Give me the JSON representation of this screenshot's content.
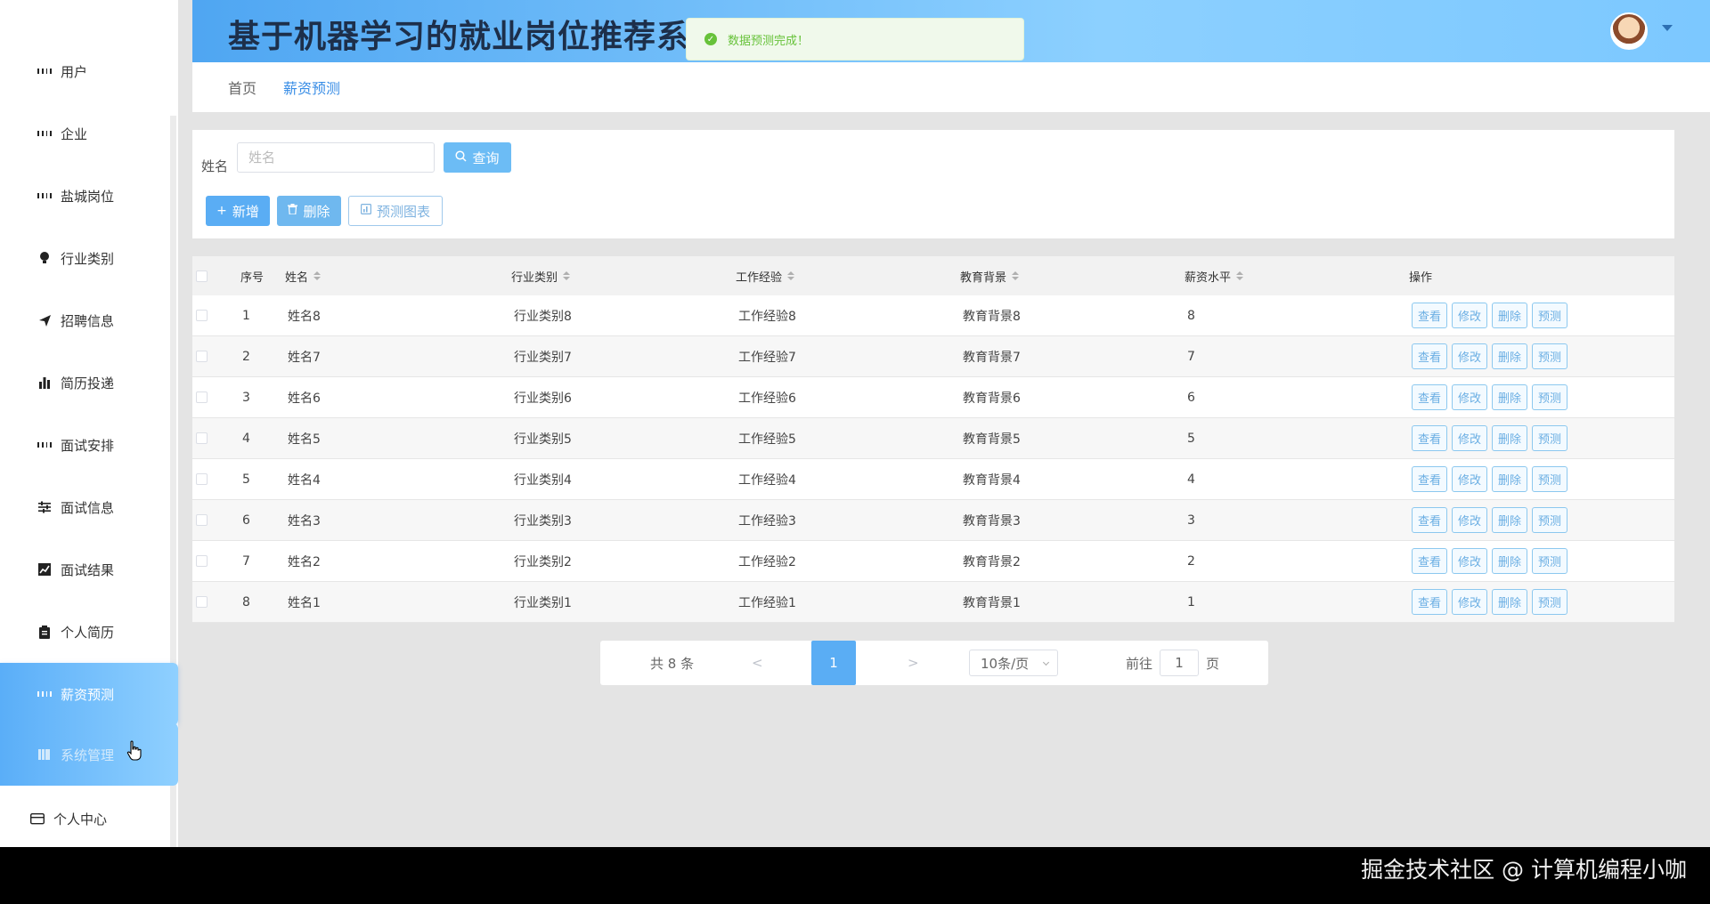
{
  "header": {
    "title": "基于机器学习的就业岗位推荐系统"
  },
  "toast": {
    "message": "数据预测完成！"
  },
  "sidebar": {
    "items": [
      {
        "label": "用户",
        "icon": "grid-icon"
      },
      {
        "label": "企业",
        "icon": "grid-icon"
      },
      {
        "label": "盐城岗位",
        "icon": "grid-icon"
      },
      {
        "label": "行业类别",
        "icon": "bulb-icon"
      },
      {
        "label": "招聘信息",
        "icon": "send-icon"
      },
      {
        "label": "简历投递",
        "icon": "bar-chart-icon"
      },
      {
        "label": "面试安排",
        "icon": "grid-icon"
      },
      {
        "label": "面试信息",
        "icon": "sliders-icon"
      },
      {
        "label": "面试结果",
        "icon": "line-chart-icon"
      },
      {
        "label": "个人简历",
        "icon": "clipboard-icon"
      },
      {
        "label": "薪资预测",
        "icon": "grid-icon"
      },
      {
        "label": "系统管理",
        "icon": "book-icon"
      },
      {
        "label": "个人中心",
        "icon": "card-icon"
      }
    ]
  },
  "breadcrumb": {
    "home": "首页",
    "current": "薪资预测"
  },
  "search": {
    "label": "姓名",
    "placeholder": "姓名",
    "query_label": "查询"
  },
  "actions": {
    "add_label": "新增",
    "delete_label": "删除",
    "chart_label": "预测图表"
  },
  "table": {
    "headers": {
      "index": "序号",
      "name": "姓名",
      "industry": "行业类别",
      "experience": "工作经验",
      "education": "教育背景",
      "salary": "薪资水平",
      "ops": "操作"
    },
    "op_labels": {
      "view": "查看",
      "edit": "修改",
      "delete": "删除",
      "predict": "预测"
    },
    "rows": [
      {
        "index": "1",
        "name": "姓名8",
        "industry": "行业类别8",
        "experience": "工作经验8",
        "education": "教育背景8",
        "salary": "8"
      },
      {
        "index": "2",
        "name": "姓名7",
        "industry": "行业类别7",
        "experience": "工作经验7",
        "education": "教育背景7",
        "salary": "7"
      },
      {
        "index": "3",
        "name": "姓名6",
        "industry": "行业类别6",
        "experience": "工作经验6",
        "education": "教育背景6",
        "salary": "6"
      },
      {
        "index": "4",
        "name": "姓名5",
        "industry": "行业类别5",
        "experience": "工作经验5",
        "education": "教育背景5",
        "salary": "5"
      },
      {
        "index": "5",
        "name": "姓名4",
        "industry": "行业类别4",
        "experience": "工作经验4",
        "education": "教育背景4",
        "salary": "4"
      },
      {
        "index": "6",
        "name": "姓名3",
        "industry": "行业类别3",
        "experience": "工作经验3",
        "education": "教育背景3",
        "salary": "3"
      },
      {
        "index": "7",
        "name": "姓名2",
        "industry": "行业类别2",
        "experience": "工作经验2",
        "education": "教育背景2",
        "salary": "2"
      },
      {
        "index": "8",
        "name": "姓名1",
        "industry": "行业类别1",
        "experience": "工作经验1",
        "education": "教育背景1",
        "salary": "1"
      }
    ]
  },
  "pagination": {
    "total": "共 8 条",
    "prev": "<",
    "current": "1",
    "next": ">",
    "page_size": "10条/页",
    "goto_label": "前往",
    "goto_value": "1",
    "page_suffix": "页"
  },
  "footer": {
    "watermark": "掘金技术社区 @ 计算机编程小咖"
  }
}
